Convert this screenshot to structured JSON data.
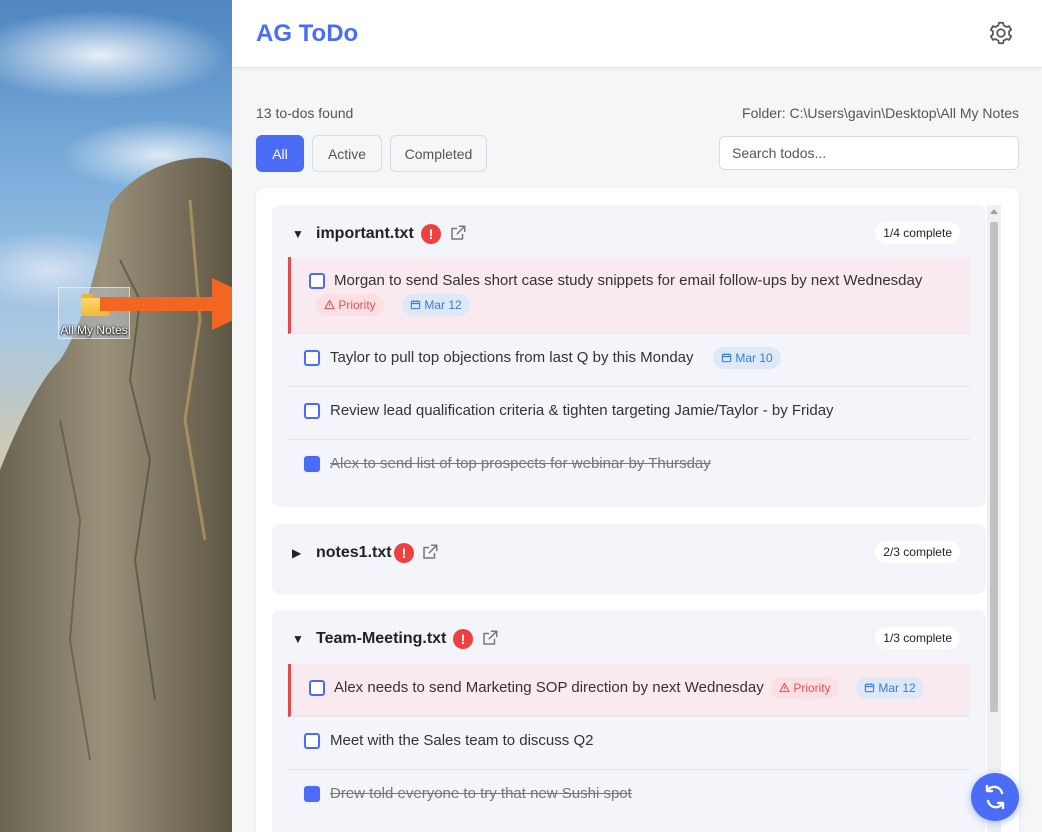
{
  "desktop": {
    "icon_label": "All My Notes"
  },
  "app": {
    "title": "AG ToDo",
    "count_text": "13 to-dos found",
    "folder_text": "Folder: C:\\Users\\gavin\\Desktop\\All My Notes",
    "filters": {
      "all": "All",
      "active": "Active",
      "completed": "Completed",
      "selected": "All"
    },
    "search_placeholder": "Search todos...",
    "files": [
      {
        "name": "important.txt",
        "expanded": true,
        "badge": "1/4 complete",
        "todos": [
          {
            "text": "Morgan to send Sales short case study snippets for email follow-ups by next Wednesday",
            "done": false,
            "priority": "Priority",
            "date": "Mar 12"
          },
          {
            "text": "Taylor to pull top objections from last Q by this Monday",
            "done": false,
            "date": "Mar 10"
          },
          {
            "text": "Review lead qualification criteria & tighten targeting Jamie/Taylor - by Friday",
            "done": false
          },
          {
            "text": "Alex to send list of top prospects for webinar by Thursday",
            "done": true
          }
        ]
      },
      {
        "name": "notes1.txt",
        "expanded": false,
        "badge": "2/3 complete"
      },
      {
        "name": "Team-Meeting.txt",
        "expanded": true,
        "badge": "1/3 complete",
        "todos": [
          {
            "text": "Alex needs to send Marketing SOP direction by next Wednesday",
            "done": false,
            "priority": "Priority",
            "date": "Mar 12"
          },
          {
            "text": "Meet with the Sales team to discuss Q2",
            "done": false
          },
          {
            "text": "Drew told everyone to try that new Sushi spot",
            "done": true
          }
        ]
      }
    ],
    "colors": {
      "accent": "#4a6cf7",
      "priority": "#e34b4b",
      "date_tag": "#3a7bd5"
    }
  }
}
